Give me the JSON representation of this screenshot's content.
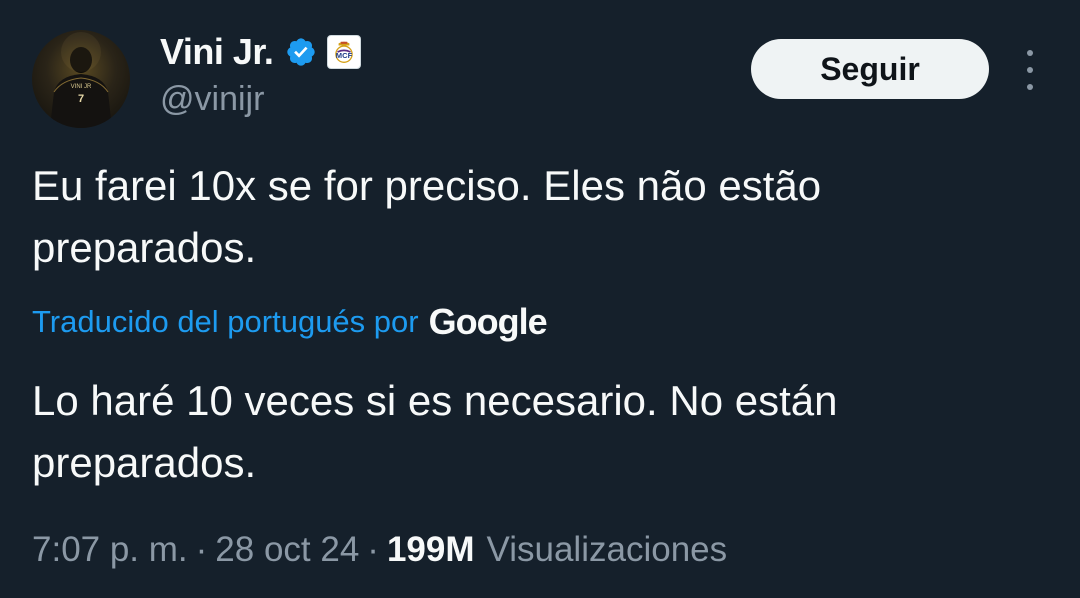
{
  "author": {
    "display_name": "Vini Jr.",
    "handle": "@vinijr",
    "verified_icon": "verified-badge-icon",
    "affiliate_icon": "real-madrid-crest-icon",
    "avatar_label": "VINI JR"
  },
  "follow_button": {
    "label": "Seguir"
  },
  "more_options_icon": "more-vertical-icon",
  "tweet": {
    "original_text": "Eu farei 10x se for preciso. Eles não estão preparados.",
    "translated_label": "Traducido del portugués por",
    "translation_provider": "Google",
    "translated_text": "Lo haré 10 veces si es necesario. No están preparados."
  },
  "meta": {
    "time": "7:07 p. m.",
    "separator": "·",
    "date": "28 oct 24",
    "views_count": "199M",
    "views_label": "Visualizaciones"
  },
  "colors": {
    "background": "#15202b",
    "text_primary": "#f7f9f9",
    "text_secondary": "#8b98a5",
    "link_blue": "#1d9bf0",
    "verified_blue": "#1d9bf0",
    "button_bg": "#eff3f4"
  }
}
